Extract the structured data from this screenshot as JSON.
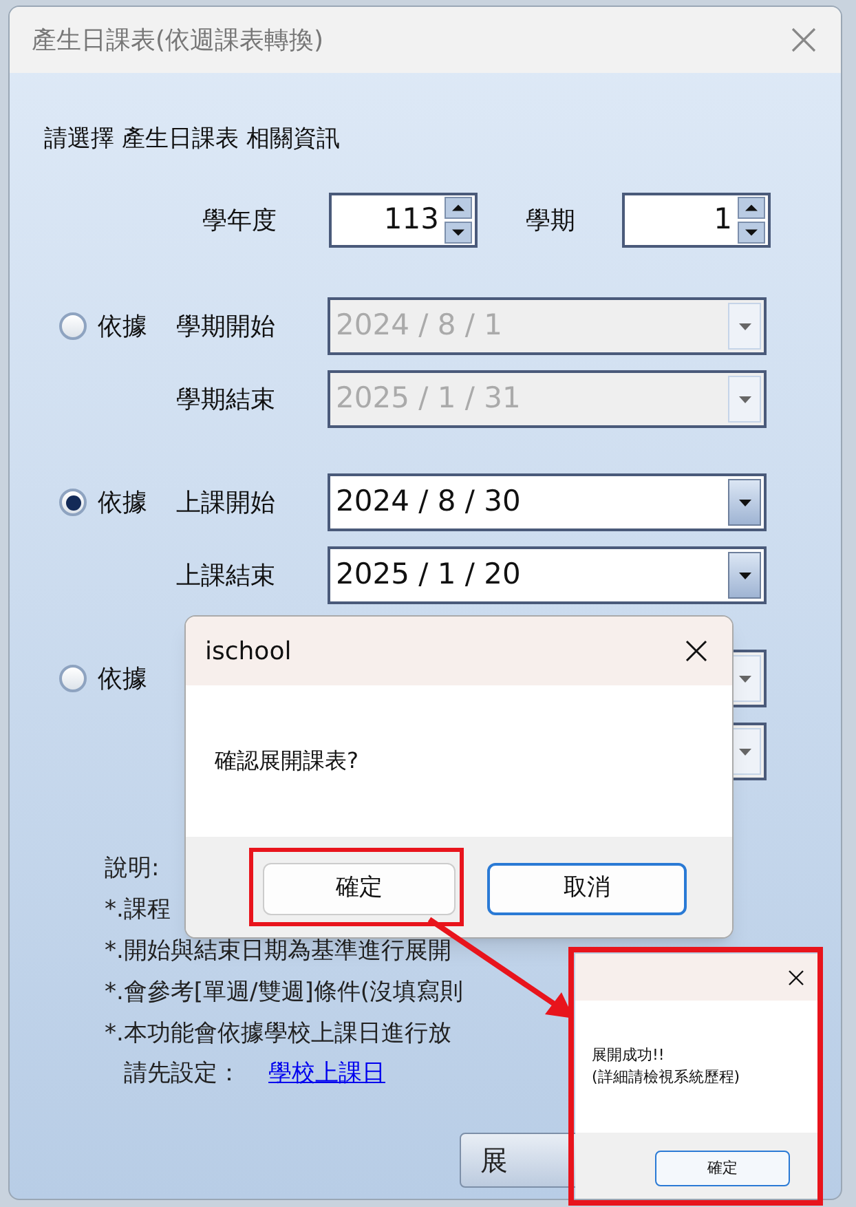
{
  "window": {
    "title": "產生日課表(依週課表轉換)"
  },
  "prompt": "請選擇 產生日課表 相關資訊",
  "school_year": {
    "label": "學年度",
    "value": "113"
  },
  "semester": {
    "label": "學期",
    "value": "1"
  },
  "options": [
    {
      "label": "依據",
      "selected": false,
      "fields": [
        {
          "label": "學期開始",
          "value": "2024 / 8 / 1",
          "disabled": true
        },
        {
          "label": "學期結束",
          "value": "2025 / 1 / 31",
          "disabled": true
        }
      ]
    },
    {
      "label": "依據",
      "selected": true,
      "fields": [
        {
          "label": "上課開始",
          "value": "2024 / 8 / 30",
          "disabled": false
        },
        {
          "label": "上課結束",
          "value": "2025 / 1 / 20",
          "disabled": false
        }
      ]
    },
    {
      "label": "依據",
      "selected": false,
      "fields": [
        {
          "disabled": true
        },
        {
          "disabled": true
        }
      ]
    }
  ],
  "notes": {
    "title": "說明:",
    "lines": [
      "*.課程",
      "*.開始與結束日期為基準進行展開",
      "*.會參考[單週/雙週]條件(沒填寫則",
      "*.本功能會依據學校上課日進行放"
    ]
  },
  "setup": {
    "label": "請先設定：",
    "link": "學校上課日"
  },
  "expand_button": "展",
  "confirm_dialog": {
    "title": "ischool",
    "message": "確認展開課表?",
    "buttons": [
      {
        "label": "確定",
        "focused": false,
        "annotated": true
      },
      {
        "label": "取消",
        "focused": true,
        "annotated": false
      }
    ]
  },
  "success_dialog": {
    "lines": [
      "展開成功!!",
      "(詳細請檢視系統歷程)"
    ],
    "button": "確定",
    "annotated": true
  }
}
